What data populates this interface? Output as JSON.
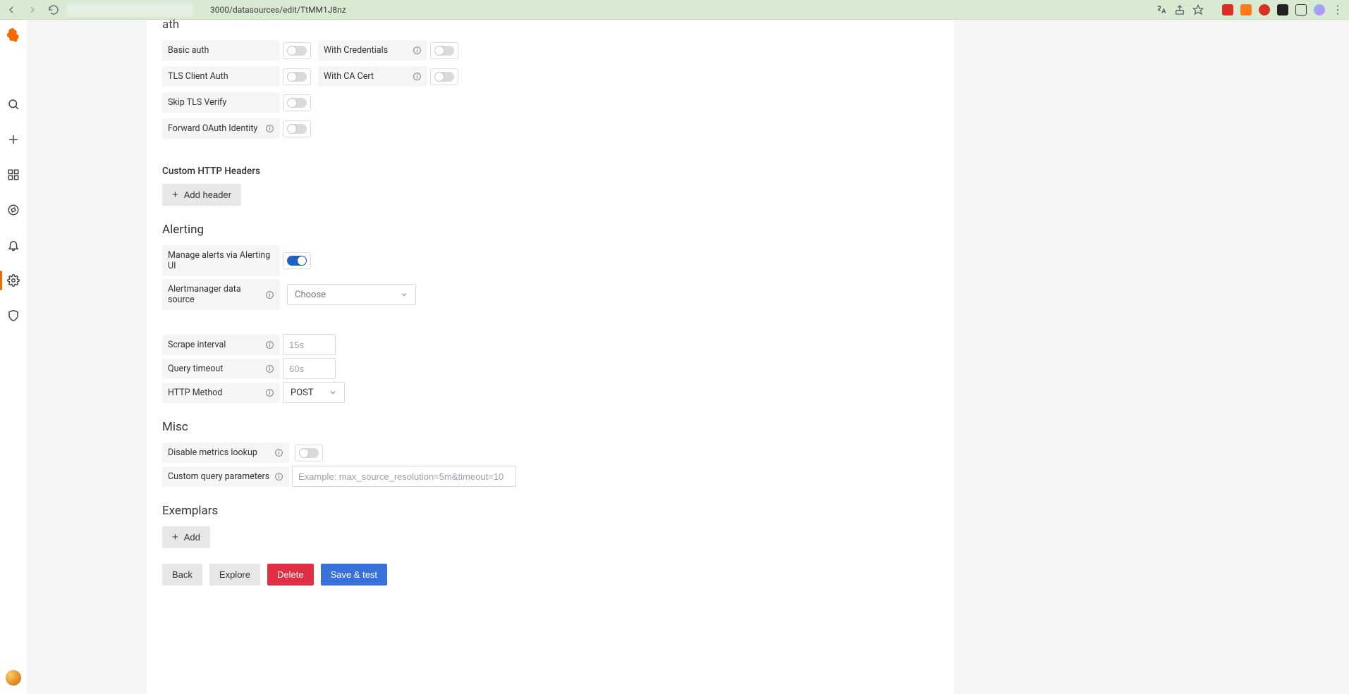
{
  "browser": {
    "url_visible": "3000/datasources/edit/TtMM1J8nz"
  },
  "sections": {
    "auth": {
      "title": "ath",
      "basic_auth": "Basic auth",
      "tls_client_auth": "TLS Client Auth",
      "skip_tls_verify": "Skip TLS Verify",
      "forward_oauth": "Forward OAuth Identity",
      "with_credentials": "With Credentials",
      "with_ca_cert": "With CA Cert"
    },
    "custom_headers": {
      "title": "Custom HTTP Headers",
      "add_btn": "Add header"
    },
    "alerting": {
      "title": "Alerting",
      "manage_label": "Manage alerts via Alerting UI",
      "am_ds_label": "Alertmanager data source",
      "am_ds_placeholder": "Choose",
      "scrape_interval": "Scrape interval",
      "scrape_placeholder": "15s",
      "query_timeout": "Query timeout",
      "query_placeholder": "60s",
      "http_method": "HTTP Method",
      "http_method_value": "POST"
    },
    "misc": {
      "title": "Misc",
      "disable_lookup": "Disable metrics lookup",
      "custom_query": "Custom query parameters",
      "custom_query_placeholder": "Example: max_source_resolution=5m&timeout=10"
    },
    "exemplars": {
      "title": "Exemplars",
      "add_btn": "Add"
    }
  },
  "footer": {
    "back": "Back",
    "explore": "Explore",
    "delete": "Delete",
    "save_test": "Save & test"
  },
  "toggles": {
    "basic_auth": false,
    "tls_client_auth": false,
    "skip_tls_verify": false,
    "forward_oauth": false,
    "with_credentials": false,
    "with_ca_cert": false,
    "manage_alerts": true,
    "disable_lookup": false
  }
}
